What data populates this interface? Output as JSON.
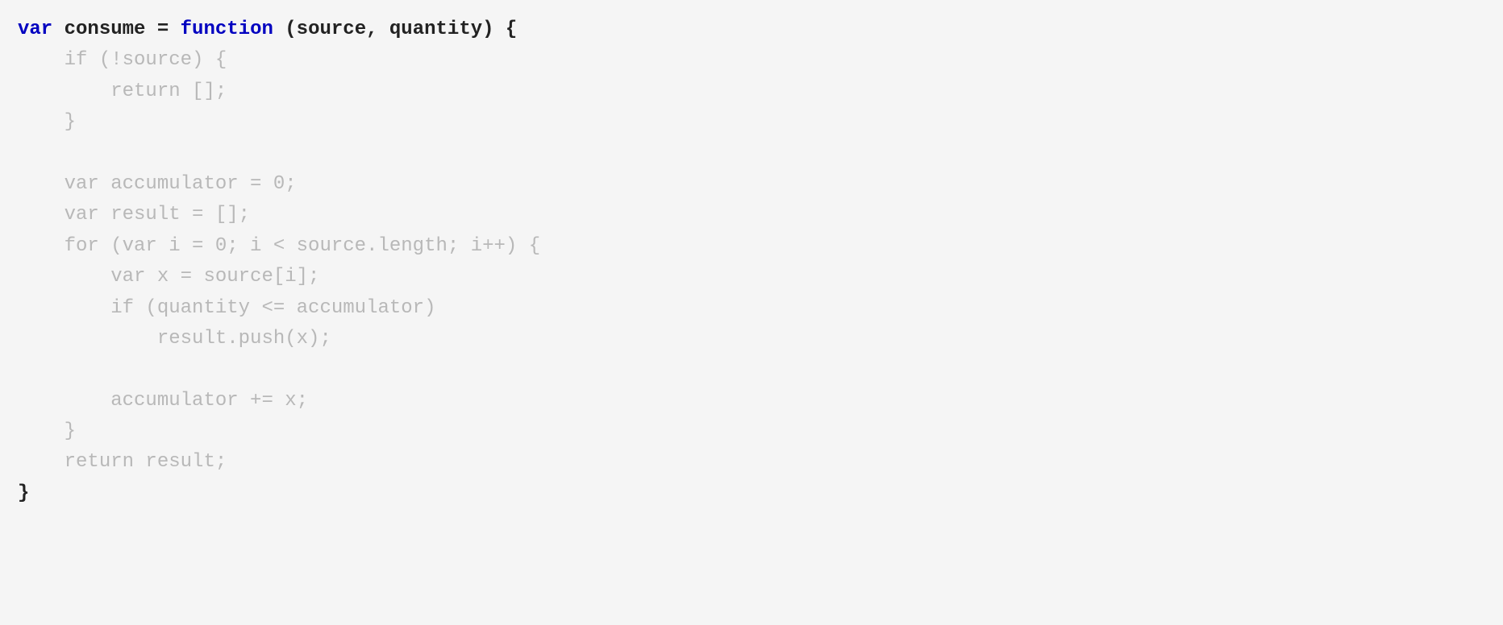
{
  "code": {
    "line1_var": "var",
    "line1_mid": " consume = ",
    "line1_function": "function",
    "line1_rest": " (source, quantity) {",
    "line2": "    if (!source) {",
    "line3": "        return [];",
    "line4": "    }",
    "line5": "",
    "line6": "    var accumulator = 0;",
    "line7": "    var result = [];",
    "line8": "    for (var i = 0; i < source.length; i++) {",
    "line9": "        var x = source[i];",
    "line10": "        if (quantity <= accumulator)",
    "line11": "            result.push(x);",
    "line12": "",
    "line13": "        accumulator += x;",
    "line14": "    }",
    "line15": "    return result;",
    "line16": "}"
  }
}
